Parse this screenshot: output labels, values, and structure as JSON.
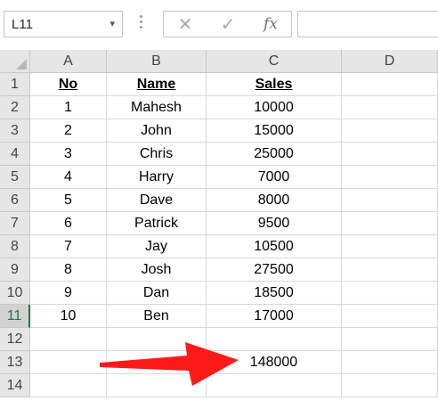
{
  "formula_bar": {
    "name_box": "L11",
    "name_box_arrow": "▾",
    "cancel_glyph": "✕",
    "enter_glyph": "✓",
    "fx_label": "fx",
    "formula": ""
  },
  "columns": [
    "A",
    "B",
    "C",
    "D"
  ],
  "rows": [
    "1",
    "2",
    "3",
    "4",
    "5",
    "6",
    "7",
    "8",
    "9",
    "10",
    "11",
    "12",
    "13",
    "14"
  ],
  "active_row": "11",
  "headers": {
    "no": "No",
    "name": "Name",
    "sales": "Sales"
  },
  "records": [
    {
      "no": "1",
      "name": "Mahesh",
      "sales": "10000"
    },
    {
      "no": "2",
      "name": "John",
      "sales": "15000"
    },
    {
      "no": "3",
      "name": "Chris",
      "sales": "25000"
    },
    {
      "no": "4",
      "name": "Harry",
      "sales": "7000"
    },
    {
      "no": "5",
      "name": "Dave",
      "sales": "8000"
    },
    {
      "no": "6",
      "name": "Patrick",
      "sales": "9500"
    },
    {
      "no": "7",
      "name": "Jay",
      "sales": "10500"
    },
    {
      "no": "8",
      "name": "Josh",
      "sales": "27500"
    },
    {
      "no": "9",
      "name": "Dan",
      "sales": "18500"
    },
    {
      "no": "10",
      "name": "Ben",
      "sales": "17000"
    }
  ],
  "total": "148000",
  "annotation": {
    "arrow_color": "#ff1a1a"
  },
  "colors": {
    "header_bg": "#e6e6e6",
    "active_accent": "#217346"
  }
}
